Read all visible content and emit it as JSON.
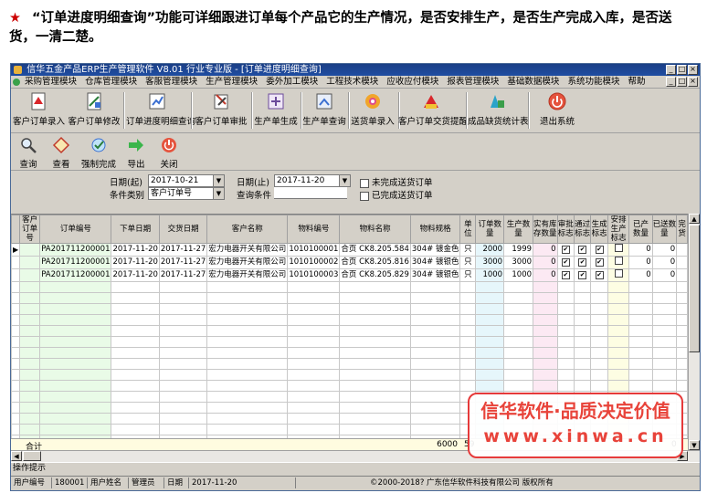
{
  "caption": {
    "star": "★",
    "text": "“订单进度明细查询”功能可详细跟进订单每个产品它的生产情况，是否安排生产，是否生产完成入库，是否送货，一清二楚。"
  },
  "window": {
    "title": "信华五金产品ERP生产管理软件  V8.01 行业专业版 - [订单进度明细查询]",
    "buttons": [
      "_",
      "□",
      "×"
    ]
  },
  "menubar": {
    "items": [
      "采购管理模块",
      "仓库管理模块",
      "客服管理模块",
      "生产管理模块",
      "委外加工模块",
      "工程技术模块",
      "应收应付模块",
      "报表管理模块",
      "基础数据模块",
      "系统功能模块",
      "帮助"
    ]
  },
  "toolbar1": {
    "buttons": [
      {
        "label": "客户订单录入",
        "icon": "order-entry-icon"
      },
      {
        "label": "客户订单修改",
        "icon": "order-edit-icon"
      },
      {
        "label": "订单进度明细查询",
        "icon": "progress-query-icon"
      },
      {
        "label": "客户订单审批",
        "icon": "order-approve-icon"
      },
      {
        "label": "生产单生成",
        "icon": "production-generate-icon"
      },
      {
        "label": "生产单查询",
        "icon": "production-query-icon"
      },
      {
        "label": "送货单录入",
        "icon": "delivery-entry-icon"
      },
      {
        "label": "客户订单交货提醒",
        "icon": "delivery-reminder-icon"
      },
      {
        "label": "成品缺货统计表",
        "icon": "shortage-stats-icon"
      },
      {
        "label": "退出系统",
        "icon": "exit-icon"
      }
    ]
  },
  "toolbar2": {
    "buttons": [
      {
        "label": "查询",
        "icon": "search-icon"
      },
      {
        "label": "查看",
        "icon": "view-icon"
      },
      {
        "label": "强制完成",
        "icon": "force-complete-icon"
      },
      {
        "label": "导出",
        "icon": "export-icon"
      },
      {
        "label": "关闭",
        "icon": "close-icon"
      }
    ]
  },
  "filter": {
    "date_from_label": "日期(起)",
    "date_from_value": "2017-10-21",
    "date_to_label": "日期(止)",
    "date_to_value": "2017-11-20",
    "category_label": "条件类别",
    "category_value": "客户订单号",
    "condition_label": "查询条件",
    "condition_value": "",
    "unfinished_label": "未完成送货订单",
    "finished_label": "已完成送货订单"
  },
  "grid": {
    "columns": [
      "客户订单号",
      "订单编号",
      "下单日期",
      "交货日期",
      "客户名称",
      "物料编号",
      "物料名称",
      "物料规格",
      "单位",
      "订单数量",
      "生产数量",
      "实有库存数量",
      "审批标志",
      "通过标志",
      "生成标志",
      "安排生产标志",
      "已产数量",
      "已送数量",
      "完货"
    ],
    "rows": [
      {
        "cust_no": "",
        "order_no": "PA201711200001",
        "order_date": "2017-11-20",
        "due_date": "2017-11-27",
        "customer": "宏力电器开关有限公司",
        "mat_no": "1010100001",
        "mat_name": "合页 CK8.205.584",
        "spec": "304# 镀金色",
        "unit": "只",
        "order_qty": "2000",
        "prod_qty": "1999",
        "stock_qty": "0",
        "approve": "✔",
        "pass": "✔",
        "gen": "✔",
        "arrange": "",
        "made_qty": "0",
        "sent_qty": "0"
      },
      {
        "cust_no": "",
        "order_no": "PA201711200001",
        "order_date": "2017-11-20",
        "due_date": "2017-11-27",
        "customer": "宏力电器开关有限公司",
        "mat_no": "1010100002",
        "mat_name": "合页 CK8.205.816",
        "spec": "304# 镀银色",
        "unit": "只",
        "order_qty": "3000",
        "prod_qty": "3000",
        "stock_qty": "0",
        "approve": "✔",
        "pass": "✔",
        "gen": "✔",
        "arrange": "",
        "made_qty": "0",
        "sent_qty": "0"
      },
      {
        "cust_no": "",
        "order_no": "PA201711200001",
        "order_date": "2017-11-20",
        "due_date": "2017-11-27",
        "customer": "宏力电器开关有限公司",
        "mat_no": "1010100003",
        "mat_name": "合页 CK8.205.829",
        "spec": "304# 镀银色",
        "unit": "只",
        "order_qty": "1000",
        "prod_qty": "1000",
        "stock_qty": "0",
        "approve": "✔",
        "pass": "✔",
        "gen": "✔",
        "arrange": "",
        "made_qty": "0",
        "sent_qty": "0"
      }
    ],
    "total_label": "合计",
    "total_order_qty": "6000",
    "total_prod_qty": "59",
    "total_sent_qty": "0"
  },
  "hint": {
    "label": "操作提示"
  },
  "status": {
    "user_no_label": "用户编号",
    "user_no": "180001",
    "user_name_label": "用户姓名",
    "user_name": "管理员",
    "date_label": "日期",
    "date": "2017-11-20",
    "copyright": "©2000-2018?  广东信华软件科技有限公司  版权所有"
  },
  "watermark": {
    "line1": "信华软件·品质决定价值",
    "line2": "www.xinwa.cn"
  },
  "colors": {
    "accent": "#e63a3a",
    "title_bar": "#1f4da2",
    "face": "#d4d0c8"
  }
}
